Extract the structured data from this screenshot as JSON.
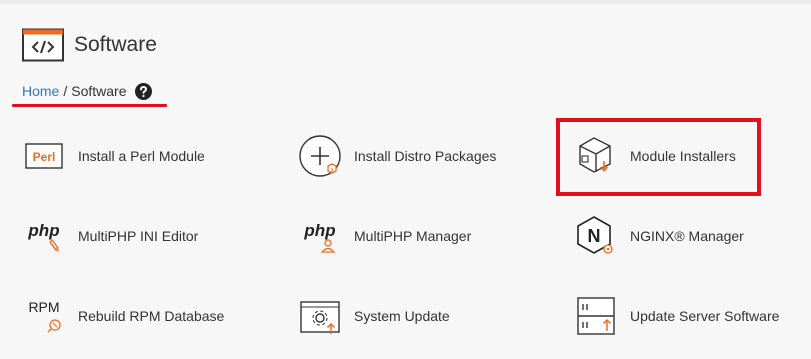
{
  "page": {
    "title": "Software",
    "breadcrumb": {
      "home": "Home",
      "separator": "/",
      "current": "Software"
    }
  },
  "items": [
    {
      "id": "perl",
      "label": "Install a Perl Module",
      "icon": "perl-icon",
      "icon_text": "Perl"
    },
    {
      "id": "distro",
      "label": "Install Distro Packages",
      "icon": "add-package-icon"
    },
    {
      "id": "module",
      "label": "Module Installers",
      "icon": "module-installer-icon"
    },
    {
      "id": "phpini",
      "label": "MultiPHP INI Editor",
      "icon": "php-editor-icon",
      "icon_text": "php"
    },
    {
      "id": "phpmgr",
      "label": "MultiPHP Manager",
      "icon": "php-manager-icon",
      "icon_text": "php"
    },
    {
      "id": "nginx",
      "label": "NGINX® Manager",
      "icon": "nginx-icon",
      "icon_text": "N"
    },
    {
      "id": "rpm",
      "label": "Rebuild RPM Database",
      "icon": "rpm-icon",
      "icon_text": "RPM"
    },
    {
      "id": "sysupdate",
      "label": "System Update",
      "icon": "system-update-icon"
    },
    {
      "id": "srvupdate",
      "label": "Update Server Software",
      "icon": "server-update-icon"
    }
  ],
  "colors": {
    "accent": "#f26a20",
    "link": "#2a7bbd",
    "highlight": "#e0111b",
    "ink": "#333333"
  }
}
